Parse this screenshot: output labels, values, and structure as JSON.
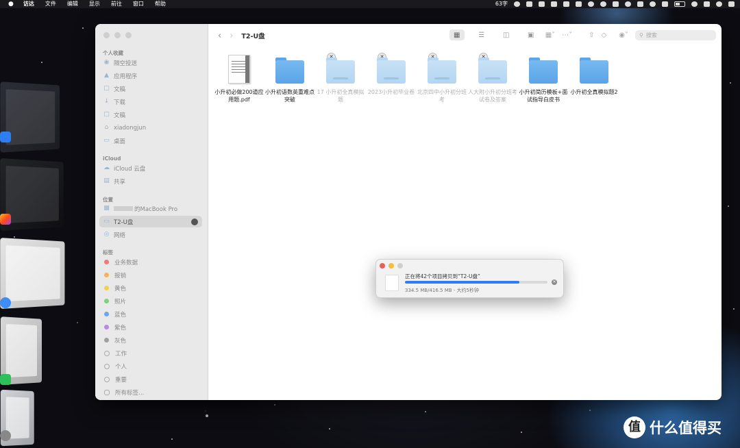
{
  "menubar": {
    "app_name": "访达",
    "menus": [
      "文件",
      "编辑",
      "显示",
      "前往",
      "窗口",
      "帮助"
    ],
    "status_text": "63字"
  },
  "window": {
    "title": "T2-U盘",
    "search_placeholder": "搜索"
  },
  "sidebar": {
    "sections": [
      {
        "title": "个人收藏",
        "items": [
          {
            "label": "隔空投送",
            "icon": "airdrop-icon"
          },
          {
            "label": "应用程序",
            "icon": "applications-icon"
          },
          {
            "label": "文稿",
            "icon": "document-icon"
          },
          {
            "label": "下载",
            "icon": "download-icon"
          },
          {
            "label": "文稿",
            "icon": "document-icon"
          },
          {
            "label": "xiadongjun",
            "icon": "home-icon"
          },
          {
            "label": "桌面",
            "icon": "desktop-icon"
          }
        ]
      },
      {
        "title": "iCloud",
        "items": [
          {
            "label": "iCloud 云盘",
            "icon": "cloud-icon"
          },
          {
            "label": "共享",
            "icon": "shared-folder-icon"
          }
        ]
      },
      {
        "title": "位置",
        "items": [
          {
            "label": "的MacBook Pro",
            "icon": "laptop-icon"
          },
          {
            "label": "T2-U盘",
            "icon": "drive-icon"
          },
          {
            "label": "网络",
            "icon": "network-icon"
          }
        ]
      },
      {
        "title": "标签",
        "items": [
          {
            "label": "业务数据",
            "color": "#f07a7a"
          },
          {
            "label": "报销",
            "color": "#f4b35a"
          },
          {
            "label": "黄色",
            "color": "#f2d24a"
          },
          {
            "label": "照片",
            "color": "#7fd07f"
          },
          {
            "label": "蓝色",
            "color": "#6aa7ee"
          },
          {
            "label": "紫色",
            "color": "#b98ae0"
          },
          {
            "label": "灰色",
            "color": "#a0a0a0"
          },
          {
            "label": "工作",
            "color": "hollow"
          },
          {
            "label": "个人",
            "color": "hollow"
          },
          {
            "label": "重要",
            "color": "hollow"
          },
          {
            "label": "所有标签…",
            "color": "all"
          }
        ]
      }
    ]
  },
  "files": [
    {
      "name": "小升初必做200道应用题.pdf",
      "type": "pdf",
      "copying": false
    },
    {
      "name": "小升初语数英重难点突破",
      "type": "folder",
      "copying": false
    },
    {
      "name": "17 小升初全真模拟题",
      "type": "folder",
      "copying": true
    },
    {
      "name": "2023小升初毕业卷",
      "type": "folder",
      "copying": true
    },
    {
      "name": "北京四中小升初分班考",
      "type": "folder",
      "copying": true
    },
    {
      "name": "人大附小升初分班考试卷及答案",
      "type": "folder",
      "copying": true
    },
    {
      "name": "小升初简历模板+面试指导白皮书",
      "type": "folder",
      "copying": false
    },
    {
      "name": "小升初全真模拟题2",
      "type": "folder",
      "copying": false
    }
  ],
  "copy_dialog": {
    "title": "正在将42个项目拷贝到“T2-U盘”",
    "status": "334.5 MB/416.5 MB - 大约5秒钟",
    "progress": 0.803
  },
  "watermark": {
    "text": "什么值得买",
    "logo_char": "值"
  }
}
